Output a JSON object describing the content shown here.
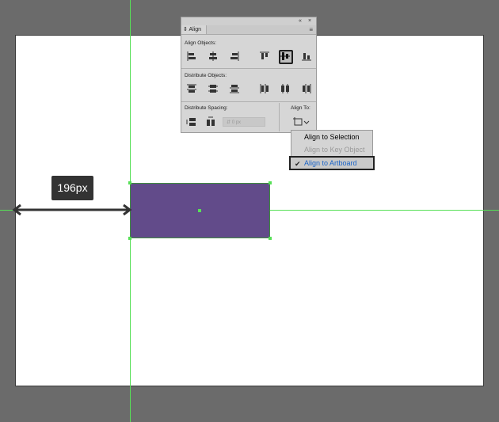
{
  "canvas": {
    "dimension_label": "196px"
  },
  "align_panel": {
    "tab_label": "Align",
    "collapse_glyph": "«",
    "close_glyph": "×",
    "menu_glyph": "≡",
    "sections": {
      "align_objects": "Align Objects:",
      "distribute_objects": "Distribute Objects:",
      "distribute_spacing": "Distribute Spacing:",
      "align_to": "Align To:"
    },
    "spacing_value": "0 px"
  },
  "align_to_menu": {
    "items": [
      {
        "label": "Align to Selection",
        "disabled": false,
        "selected": false
      },
      {
        "label": "Align to Key Object",
        "disabled": true,
        "selected": false
      },
      {
        "label": "Align to Artboard",
        "disabled": false,
        "selected": true
      }
    ]
  },
  "colors": {
    "guide": "#57e057",
    "shape_fill": "#624b8a",
    "artboard": "#ffffff",
    "pasteboard": "#6b6b6b",
    "selected_item_text": "#1a63c7"
  }
}
